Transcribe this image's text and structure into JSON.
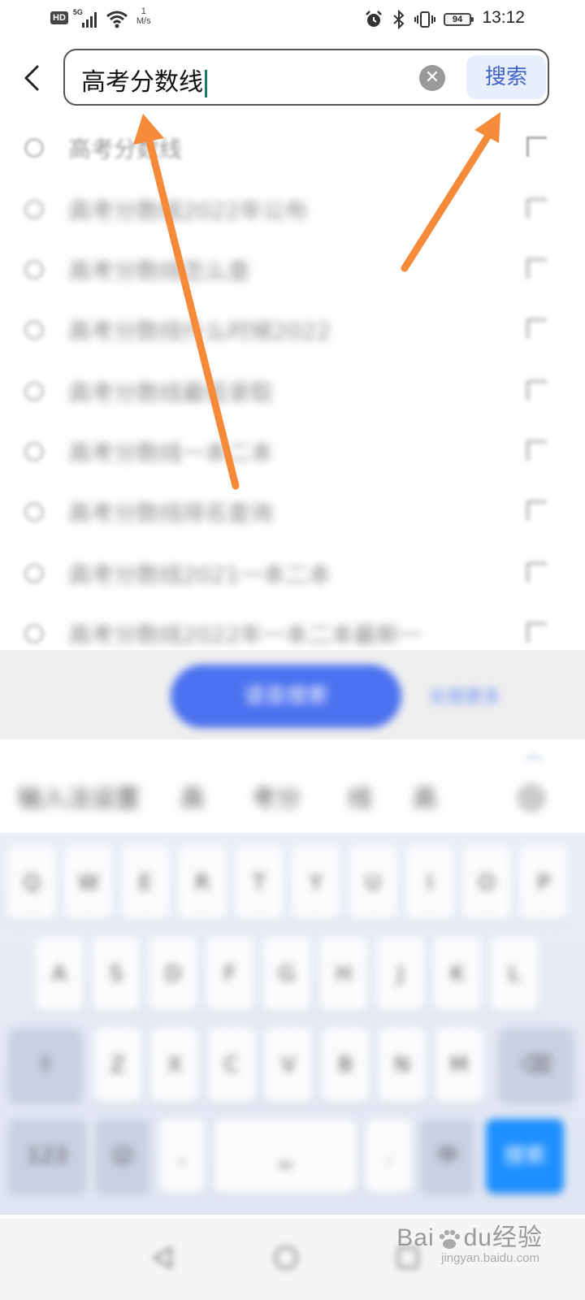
{
  "status_bar": {
    "hd": "HD",
    "network": "5G",
    "speed_value": "1",
    "speed_unit": "M/s",
    "battery": "94",
    "time": "13:12"
  },
  "search": {
    "query": "高考分数线",
    "button_label": "搜索"
  },
  "suggestions": [
    {
      "text": "高考分数线"
    },
    {
      "text": "高考分数线2022年公布"
    },
    {
      "text": "高考分数线怎么查"
    },
    {
      "text": "高考分数线什么时候2022"
    },
    {
      "text": "高考分数线最低录取"
    },
    {
      "text": "高考分数线一本二本"
    },
    {
      "text": "高考分数线排名查询"
    },
    {
      "text": "高考分数线2021一本二本"
    },
    {
      "text": "高考分数线2022年一本二本最新一"
    }
  ],
  "keyboard": {
    "voice_label": "语音搜索",
    "link_label": "长按更多",
    "candidates": [
      "输入法设置",
      "高",
      "考分",
      "线",
      "高"
    ],
    "row1": [
      "Q",
      "W",
      "E",
      "R",
      "T",
      "Y",
      "U",
      "I",
      "O",
      "P"
    ],
    "row2": [
      "A",
      "S",
      "D",
      "F",
      "G",
      "H",
      "J",
      "K",
      "L"
    ],
    "row3": [
      "Z",
      "X",
      "C",
      "V",
      "B",
      "N",
      "M"
    ],
    "num_key": "123",
    "lang_key": "中",
    "search_key": "搜索"
  },
  "watermark": {
    "brand_a": "Bai",
    "brand_b": "du",
    "brand_c": "经验",
    "sub": "jingyan.baidu.com"
  },
  "colors": {
    "annotation_arrow": "#f58a3b",
    "search_button_bg": "#e7eefc",
    "search_button_text": "#3f63c8",
    "caret": "#1a7a6a",
    "voice_button": "#4c71f0",
    "keyboard_action": "#1e8fff"
  }
}
